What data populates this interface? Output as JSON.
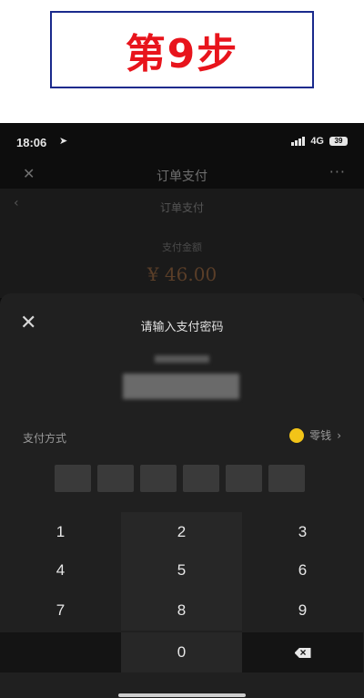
{
  "banner": {
    "text": "第9步"
  },
  "status_bar": {
    "time": "18:06",
    "network": "4G",
    "battery": "39"
  },
  "nav": {
    "title": "订单支付"
  },
  "background_page": {
    "subtitle": "订单支付",
    "amount_label": "支付金额",
    "amount": "¥ 46.00"
  },
  "password_sheet": {
    "title": "请输入支付密码",
    "payment_label": "支付方式",
    "payment_method": "零钱"
  },
  "keypad": {
    "keys": [
      "1",
      "2",
      "3",
      "4",
      "5",
      "6",
      "7",
      "8",
      "9",
      "0"
    ]
  },
  "colors": {
    "banner_text": "#e8141c",
    "banner_border": "#1a2a8c",
    "coin": "#f2c418"
  },
  "icons": [
    "location-arrow-icon",
    "signal-icon",
    "battery-icon",
    "close-icon",
    "more-icon",
    "back-icon",
    "chevron-right-icon",
    "delete-key-icon"
  ]
}
